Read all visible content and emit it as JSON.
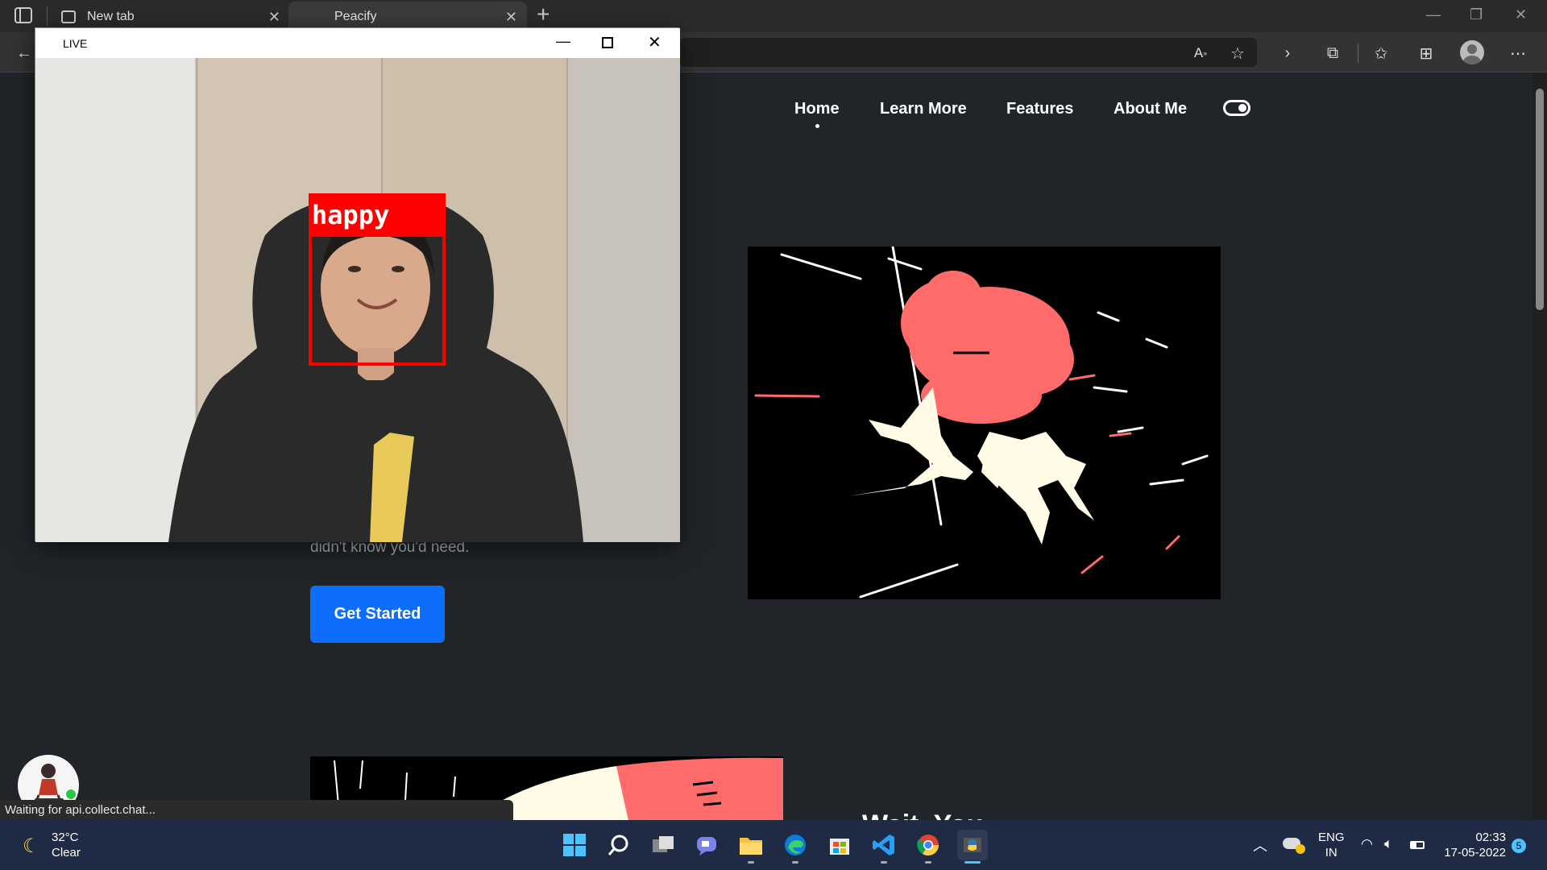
{
  "browser": {
    "tabs": [
      {
        "label": "New tab"
      },
      {
        "label": "Peacify"
      }
    ],
    "new_tab_symbol": "+",
    "icons": [
      "sidebar-icon",
      "back-icon",
      "read-aloud-icon",
      "favorite-add-icon",
      "chevron-right-icon",
      "extensions-icon",
      "favorites-icon",
      "collections-icon",
      "profile-icon",
      "more-icon"
    ]
  },
  "live_window": {
    "title": "LIVE",
    "emotion_label": "happy",
    "controls": [
      "minimize",
      "maximize",
      "close"
    ]
  },
  "site": {
    "nav": [
      {
        "label": "Home",
        "active": true
      },
      {
        "label": "Learn More"
      },
      {
        "label": "Features"
      },
      {
        "label": "About Me"
      }
    ],
    "hero_subtext": "didn't know you'd need.",
    "cta_label": "Get Started",
    "section_heading_partial": "Wait, You"
  },
  "status_bar": {
    "text": "Waiting for api.collect.chat..."
  },
  "taskbar": {
    "weather": {
      "temp": "32°C",
      "condition": "Clear"
    },
    "apps": [
      "start",
      "search",
      "task-view",
      "teams-chat",
      "file-explorer",
      "edge",
      "store",
      "vscode",
      "chrome",
      "python"
    ],
    "language": {
      "line1": "ENG",
      "line2": "IN"
    },
    "clock": {
      "time": "02:33",
      "date": "17-05-2022"
    },
    "notifications": "5"
  },
  "colors": {
    "accent": "#0d6efd",
    "page_bg": "#212529",
    "taskbar_bg": "#1f2a44",
    "detection_box": "#ff0000",
    "hero_pink": "#ff6b6b",
    "hero_cream": "#fffbe6"
  }
}
